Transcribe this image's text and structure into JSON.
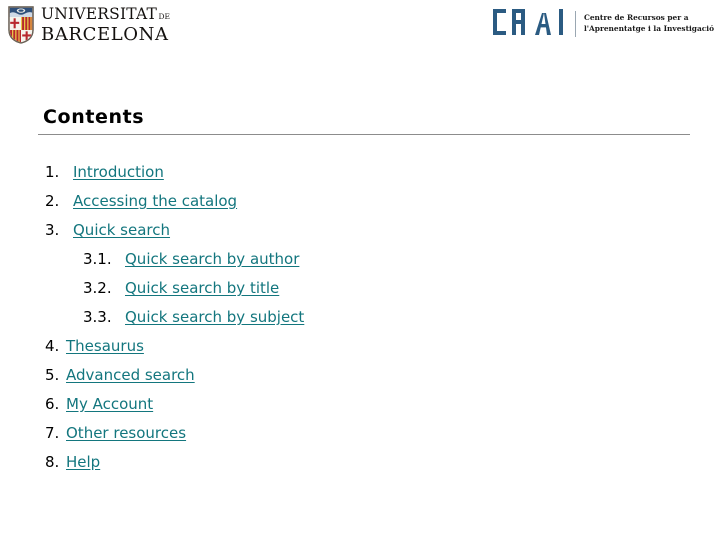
{
  "header": {
    "ub_logo": {
      "line1": "UNIVERSITAT",
      "line1_suffix": "DE",
      "line2": "BARCELONA",
      "shield_alt": "ub-coat-of-arms"
    },
    "crai_logo": {
      "mark": "CRAI",
      "tagline_line1": "Centre de Recursos per a",
      "tagline_line2": "l'Aprenentatge i la Investigació"
    }
  },
  "main": {
    "title": "Contents",
    "toc": [
      {
        "number": "1.",
        "label": "Introduction",
        "level": 1
      },
      {
        "number": "2.",
        "label": "Accessing the catalog",
        "level": 1
      },
      {
        "number": "3.",
        "label": "Quick search",
        "level": 1
      },
      {
        "number": "3.1.",
        "label": "Quick search by author",
        "level": 2
      },
      {
        "number": "3.2.",
        "label": "Quick search by title",
        "level": 2
      },
      {
        "number": "3.3.",
        "label": "Quick search by subject",
        "level": 2
      },
      {
        "number": "4.",
        "label": "Thesaurus",
        "level": 1
      },
      {
        "number": "5.",
        "label": "Advanced search",
        "level": 1
      },
      {
        "number": "6.",
        "label": "My Account",
        "level": 1
      },
      {
        "number": "7.",
        "label": "Other resources",
        "level": 1
      },
      {
        "number": "8.",
        "label": "Help",
        "level": 1
      }
    ]
  },
  "colors": {
    "link": "#13767e",
    "rule": "#8c8c8c",
    "crai_blue": "#2b5b82",
    "text": "#000000",
    "background": "#ffffff"
  }
}
